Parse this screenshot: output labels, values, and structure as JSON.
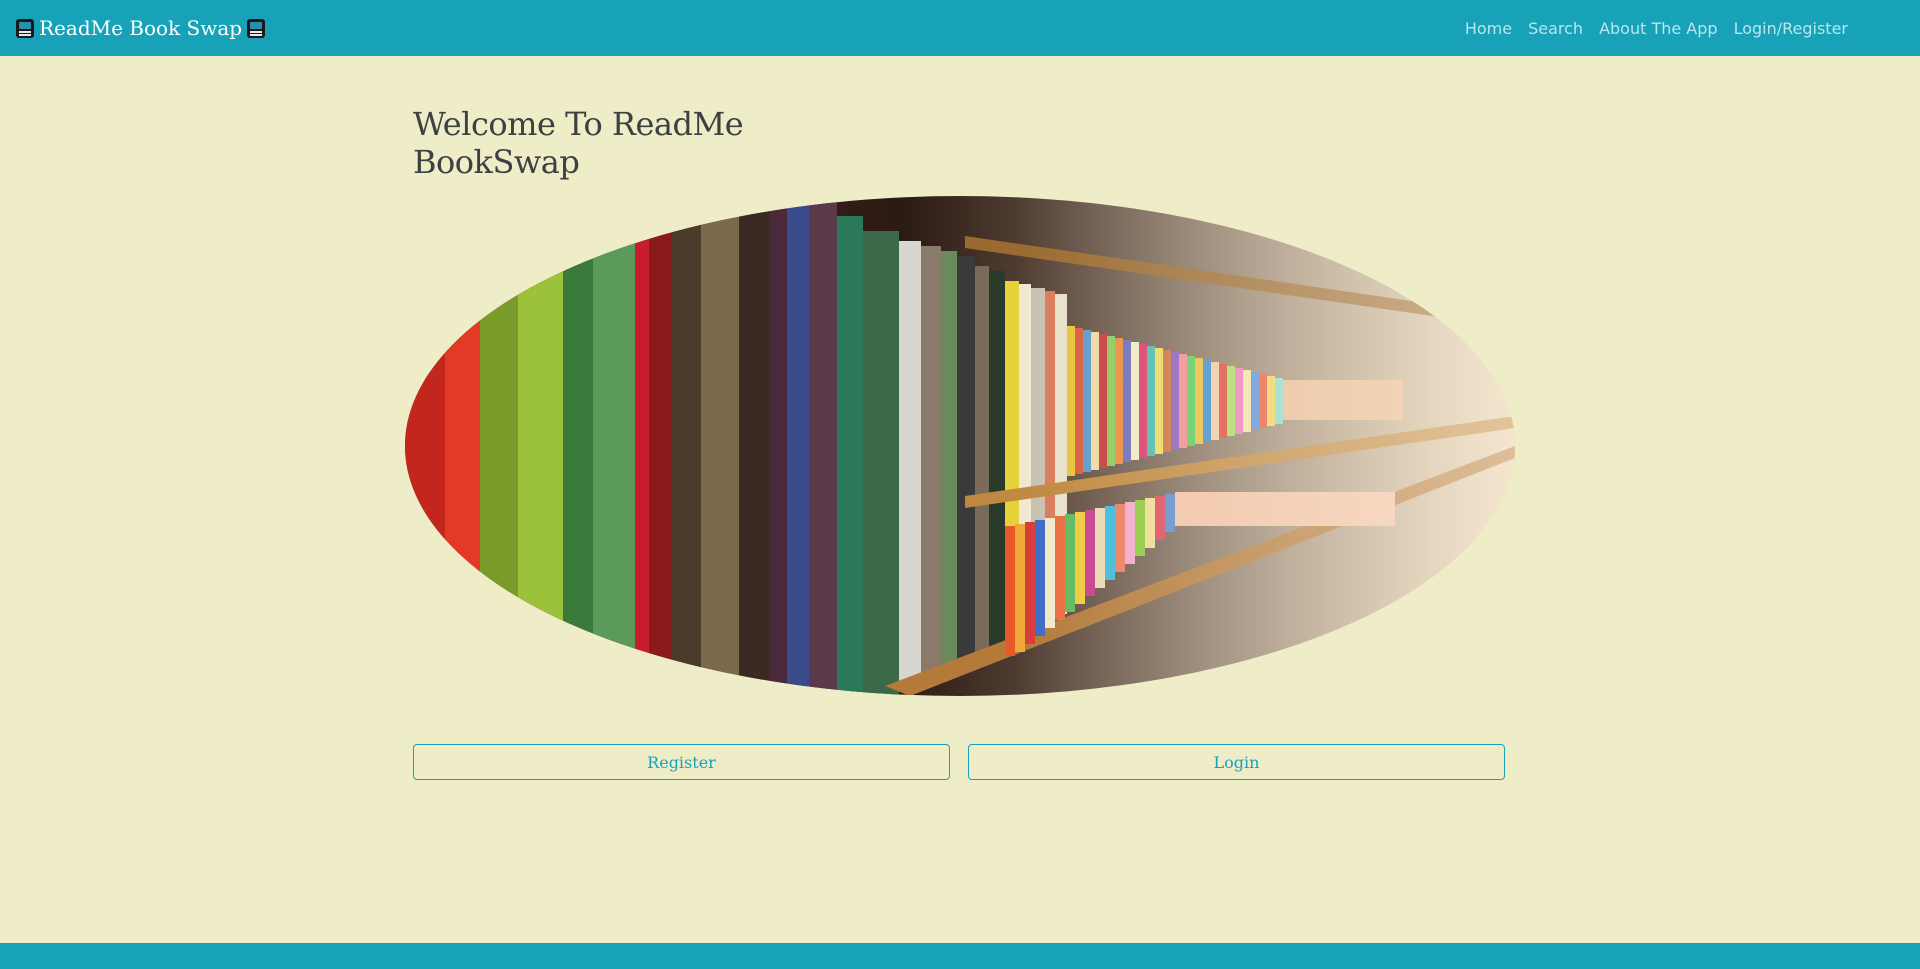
{
  "navbar": {
    "brand_text": "ReadMe Book Swap",
    "brand_icon": "book-icon",
    "links": [
      "Home",
      "Search",
      "About The App",
      "Login/Register"
    ]
  },
  "main": {
    "title": "Welcome To ReadMe BookSwap",
    "hero_image": "bookshelf-photo",
    "register_label": "Register",
    "login_label": "Login"
  },
  "colors": {
    "primary": "#17a2b8",
    "background": "#eeedc8",
    "nav_link": "#b9e6ee"
  }
}
